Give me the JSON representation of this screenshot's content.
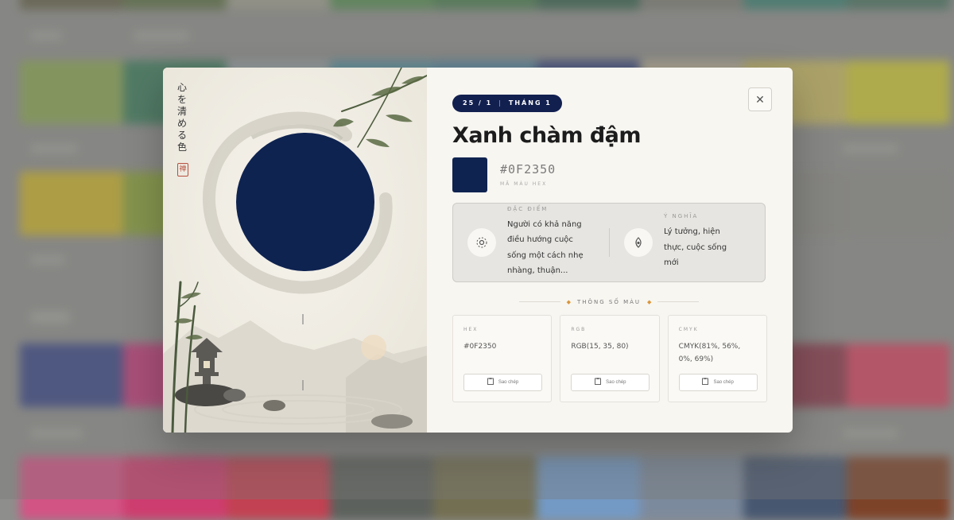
{
  "background": {
    "rows": [
      [
        "#5e5b3e",
        "#556b3a",
        "#a0a090",
        "#4d8c4a",
        "#3f7a46",
        "#2a5c45",
        "#7a7a72",
        "#2e7d6d",
        "#3f6e5a"
      ],
      [
        "#8aa94a",
        "#2f7a55",
        "#9ca7ac",
        "#4d93a8",
        "#4a86a6",
        "#2c3e80",
        "#c2b79a",
        "#d0bf5a",
        "#d6d029"
      ],
      [
        "#d4b81c",
        "#89a52a",
        "#7e9e3a",
        "#7c8f6c",
        "#7a8a7a",
        "#8e8f8a",
        "#8d8d88",
        "#8b8a85",
        "#8d8c88"
      ],
      [
        "#2c3b86",
        "#cc2c78",
        "#9a4f6a",
        "#7a6f72",
        "#736d78",
        "#6c6c7e",
        "#7d6e70",
        "#8a2a40",
        "#e0385a"
      ],
      [
        "#de4a84",
        "#d9306a",
        "#cc3448",
        "#555a55",
        "#6f6a48",
        "#6f9ccf",
        "#7a8aa0",
        "#3c4e6c",
        "#7b3618"
      ]
    ]
  },
  "art": {
    "vertical_text": "心を清める色",
    "seal": "禅",
    "color": "#0F2350"
  },
  "date_pill": {
    "day": "25 / 1",
    "month": "THÁNG 1"
  },
  "title": "Xanh chàm đậm",
  "hex": {
    "value": "#0F2350",
    "label": "MÃ MÀU HEX"
  },
  "traits": [
    {
      "icon": "sparkle-icon",
      "label": "ĐẶC ĐIỂM",
      "text": "Người có khả năng điều hướng cuộc sống một cách nhẹ nhàng, thuận..."
    },
    {
      "icon": "lotus-icon",
      "label": "Ý NGHĨA",
      "text": "Lý tưởng, hiện thực, cuộc sống mới"
    }
  ],
  "specs_heading": "THÔNG SỐ MÀU",
  "specs": [
    {
      "label": "HEX",
      "value": "#0F2350",
      "copy": "Sao chép"
    },
    {
      "label": "RGB",
      "value": "RGB(15, 35, 80)",
      "copy": "Sao chép"
    },
    {
      "label": "CMYK",
      "value": "CMYK(81%, 56%, 0%, 69%)",
      "copy": "Sao chép"
    }
  ],
  "close_icon": "close-icon"
}
